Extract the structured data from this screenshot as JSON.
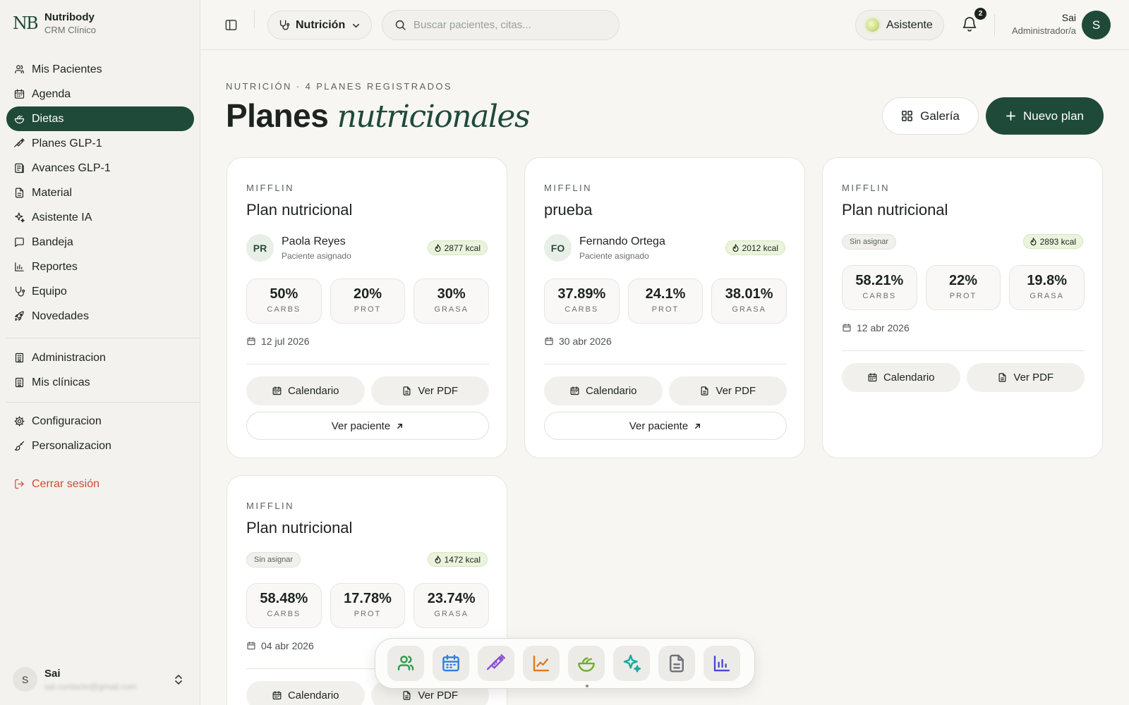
{
  "brand": {
    "logo": "NB",
    "name": "Nutribody",
    "subtitle": "CRM Clínico"
  },
  "sidebar": {
    "groups": [
      [
        {
          "label": "Mis Pacientes",
          "icon": "users-icon"
        },
        {
          "label": "Agenda",
          "icon": "calendar-icon"
        },
        {
          "label": "Dietas",
          "icon": "salad-bowl-icon",
          "active": true
        },
        {
          "label": "Planes GLP-1",
          "icon": "syringe-icon"
        },
        {
          "label": "Avances GLP-1",
          "icon": "progress-icon"
        },
        {
          "label": "Material",
          "icon": "document-icon"
        },
        {
          "label": "Asistente IA",
          "icon": "sparkles-icon"
        },
        {
          "label": "Bandeja",
          "icon": "message-icon"
        },
        {
          "label": "Reportes",
          "icon": "bar-chart-icon"
        },
        {
          "label": "Equipo",
          "icon": "stethoscope-icon"
        },
        {
          "label": "Novedades",
          "icon": "rocket-icon"
        }
      ],
      [
        {
          "label": "Administracion",
          "icon": "building-icon"
        },
        {
          "label": "Mis clínicas",
          "icon": "building-icon"
        }
      ],
      [
        {
          "label": "Configuracion",
          "icon": "gear-icon"
        },
        {
          "label": "Personalizacion",
          "icon": "brush-icon"
        }
      ],
      [
        {
          "label": "Cerrar sesión",
          "icon": "logout-icon",
          "danger": true
        }
      ]
    ],
    "footer_user": {
      "initial": "S",
      "name": "Sai",
      "email": "sai.contacto@gmail.com"
    }
  },
  "topbar": {
    "module_select": "Nutrición",
    "search_placeholder": "Buscar pacientes, citas...",
    "assistant_label": "Asistente",
    "notifications_count": "2",
    "user_name": "Sai",
    "user_role": "Administrador/a",
    "user_initial": "S"
  },
  "header": {
    "eyebrow": "NUTRICIÓN · 4 PLANES REGISTRADOS",
    "title_plain": "Planes",
    "title_italic": "nutricionales",
    "gallery_label": "Galería",
    "new_plan_label": "Nuevo plan"
  },
  "plans": [
    {
      "method": "MIFFLIN",
      "title": "Plan nutricional",
      "patient_initials": "PR",
      "patient_name": "Paola Reyes",
      "patient_sub": "Paciente asignado",
      "kcal": "2877 kcal",
      "macros": [
        {
          "value": "50%",
          "label": "CARBS"
        },
        {
          "value": "20%",
          "label": "PROT"
        },
        {
          "value": "30%",
          "label": "GRASA"
        }
      ],
      "date": "12 jul 2026",
      "calendar_label": "Calendario",
      "pdf_label": "Ver PDF",
      "view_patient_label": "Ver paciente"
    },
    {
      "method": "MIFFLIN",
      "title": "prueba",
      "patient_initials": "FO",
      "patient_name": "Fernando Ortega",
      "patient_sub": "Paciente asignado",
      "kcal": "2012 kcal",
      "macros": [
        {
          "value": "37.89%",
          "label": "CARBS"
        },
        {
          "value": "24.1%",
          "label": "PROT"
        },
        {
          "value": "38.01%",
          "label": "GRASA"
        }
      ],
      "date": "30 abr 2026",
      "calendar_label": "Calendario",
      "pdf_label": "Ver PDF",
      "view_patient_label": "Ver paciente"
    },
    {
      "method": "MIFFLIN",
      "title": "Plan nutricional",
      "unassigned_label": "Sin asignar",
      "kcal": "2893 kcal",
      "macros": [
        {
          "value": "58.21%",
          "label": "CARBS"
        },
        {
          "value": "22%",
          "label": "PROT"
        },
        {
          "value": "19.8%",
          "label": "GRASA"
        }
      ],
      "date": "12 abr 2026",
      "calendar_label": "Calendario",
      "pdf_label": "Ver PDF"
    },
    {
      "method": "MIFFLIN",
      "title": "Plan nutricional",
      "unassigned_label": "Sin asignar",
      "kcal": "1472 kcal",
      "macros": [
        {
          "value": "58.48%",
          "label": "CARBS"
        },
        {
          "value": "17.78%",
          "label": "PROT"
        },
        {
          "value": "23.74%",
          "label": "GRASA"
        }
      ],
      "date": "04 abr 2026",
      "calendar_label": "Calendario",
      "pdf_label": "Ver PDF"
    }
  ],
  "dock": [
    {
      "icon": "users-icon",
      "color": "#2e9a4f"
    },
    {
      "icon": "calendar-icon",
      "color": "#2f7fe0"
    },
    {
      "icon": "syringe-icon",
      "color": "#8a4fd6"
    },
    {
      "icon": "line-chart-icon",
      "color": "#e07a1f"
    },
    {
      "icon": "salad-bowl-icon",
      "color": "#6fae2a"
    },
    {
      "icon": "sparkles-icon",
      "color": "#17a9a0"
    },
    {
      "icon": "document-icon",
      "color": "#6b6f76"
    },
    {
      "icon": "bar-chart-icon",
      "color": "#4b49d1"
    }
  ],
  "colors": {
    "primary": "#1f4a3a",
    "danger": "#d24a32",
    "kcal_bg": "#eaf3dc"
  }
}
